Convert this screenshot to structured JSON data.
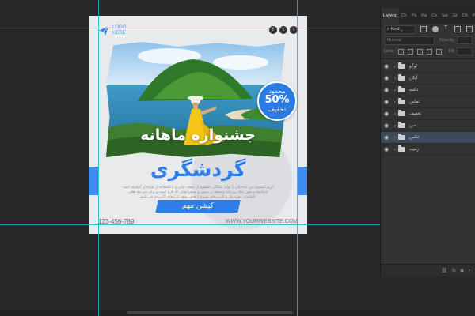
{
  "artwork": {
    "logo": {
      "line1": "LOGO",
      "line2": "HERE"
    },
    "socials": [
      "f",
      "t",
      "i"
    ],
    "badge": {
      "top": "محدود",
      "percent": "50%",
      "bottom": "تخفیف"
    },
    "headline": "جشنواره ماهانه",
    "title": "گردشگری",
    "description": "لورم ایپسوم متن ساختگی با تولید سادگی نامفهوم از صنعت چاپ و با استفاده از طراحان گرافیک است چاپگرها و متون بلکه روزنامه و مجله در ستون و سطرآنچنان که لازم است و برای شرایط فعلی تکنولوژی مورد نیاز و کاربردهای متنوع با هدف بهبود ابزارهای کاربردی می باشد",
    "cta": "کپشن مهم",
    "phone": "123-456-789",
    "website": "WWW.YOURWEBSITE.COM"
  },
  "layers_panel": {
    "tabs": [
      "Layers",
      "Ch",
      "Pa",
      "Pa",
      "Co",
      "Sw",
      "Gr",
      "Ch",
      "Pa"
    ],
    "filter_kind": "Kind",
    "blend_mode": "Normal",
    "opacity_label": "Opacity:",
    "fill_label": "Fill:",
    "lock_label": "Lock:",
    "layers": [
      {
        "name": "لوگو",
        "selected": false
      },
      {
        "name": "آیکن",
        "selected": false
      },
      {
        "name": "دکمه",
        "selected": false
      },
      {
        "name": "تماس",
        "selected": false
      },
      {
        "name": "تخفیف",
        "selected": false
      },
      {
        "name": "متن",
        "selected": false
      },
      {
        "name": "عکس",
        "selected": true
      },
      {
        "name": "زمینه",
        "selected": false
      }
    ],
    "bottom_icons": [
      "link-icon",
      "fx-icon",
      "mask-icon",
      "adjustment-icon"
    ]
  },
  "colors": {
    "accent": "#2f7de6",
    "canvas_bg": "#282828",
    "panel_bg": "#323232",
    "guide": "#1fb7c4"
  }
}
